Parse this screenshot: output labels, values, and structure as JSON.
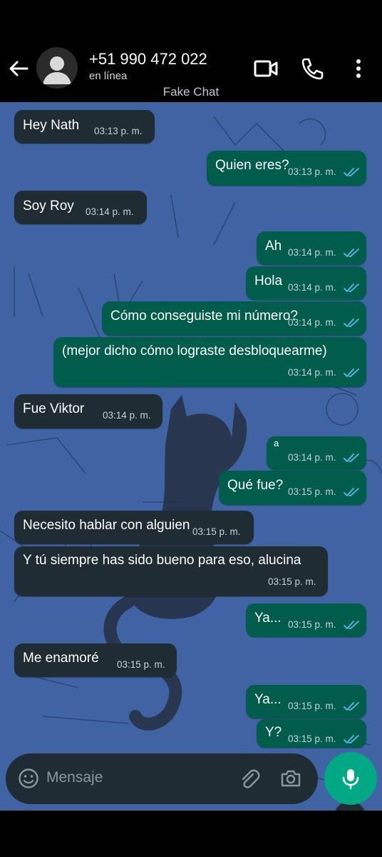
{
  "header": {
    "contact_name": "+51 990 472 022",
    "status": "en línea",
    "watermark": "Fake Chat",
    "icons": [
      "back-arrow-icon",
      "avatar-icon",
      "video-call-icon",
      "phone-icon",
      "more-vert-icon"
    ]
  },
  "messages": [
    {
      "dir": "in",
      "text": "Hey Nath",
      "time": "03:13 p. m."
    },
    {
      "dir": "out",
      "text": "Quien eres?",
      "time": "03:13 p. m."
    },
    {
      "dir": "in",
      "text": "Soy Roy",
      "time": "03:14 p. m."
    },
    {
      "dir": "out",
      "text": "Ah",
      "time": "03:14 p. m."
    },
    {
      "dir": "out",
      "text": "Hola",
      "time": "03:14 p. m."
    },
    {
      "dir": "out",
      "text": "Cómo conseguiste mi número?",
      "time": "03:14 p. m."
    },
    {
      "dir": "out",
      "text": "(mejor dicho cómo lograste desbloquearme)",
      "time": "03:14 p. m."
    },
    {
      "dir": "in",
      "text": "Fue Viktor",
      "time": "03:14 p. m."
    },
    {
      "dir": "out",
      "text": "a",
      "time": "03:14 p. m."
    },
    {
      "dir": "out",
      "text": "Qué fue?",
      "time": "03:15 p. m."
    },
    {
      "dir": "in",
      "text": "Necesito hablar con alguien",
      "time": "03:15 p. m."
    },
    {
      "dir": "in",
      "text": "Y tú siempre has sido bueno para eso, alucina",
      "time": "03:15 p. m."
    },
    {
      "dir": "out",
      "text": "Ya...",
      "time": "03:15 p. m."
    },
    {
      "dir": "in",
      "text": "Me enamoré",
      "time": "03:15 p. m."
    },
    {
      "dir": "out",
      "text": "Ya...",
      "time": "03:15 p. m."
    },
    {
      "dir": "out",
      "text": "Y?",
      "time": "03:15 p. m."
    }
  ],
  "composer": {
    "placeholder": "Mensaje",
    "icons": [
      "emoji-icon",
      "attach-icon",
      "camera-icon",
      "mic-icon"
    ]
  },
  "colors": {
    "incoming_bubble": "#1f2c34",
    "outgoing_bubble": "#005c4b",
    "chat_background": "#4063a4",
    "read_ticks": "#53bdeb",
    "mic_button": "#00a884"
  }
}
